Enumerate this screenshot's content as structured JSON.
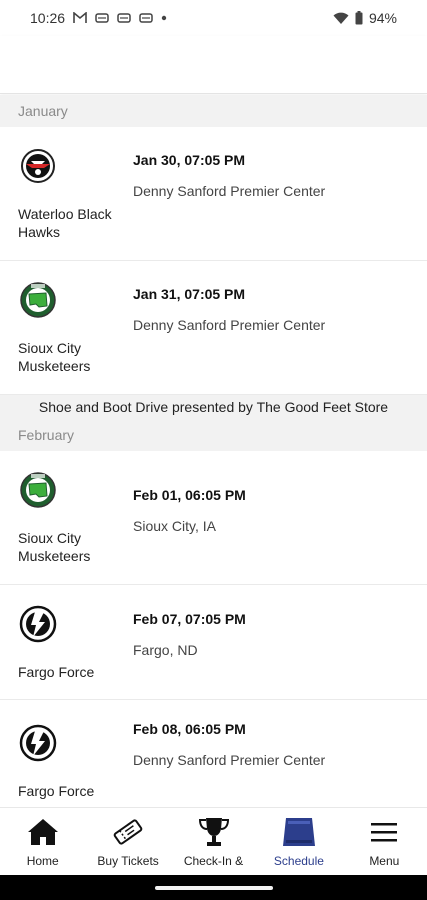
{
  "status_bar": {
    "time": "10:26",
    "battery": "94%",
    "notification_icons": [
      "gmail-icon",
      "notification-icon",
      "notification-icon",
      "notification-icon"
    ]
  },
  "schedule": {
    "sections": [
      {
        "month": "January",
        "games": [
          {
            "opponent": "Waterloo Black Hawks",
            "date_time": "Jan 30, 07:05 PM",
            "venue": "Denny Sanford Premier Center",
            "logo": "waterloo-logo"
          },
          {
            "opponent": "Sioux City Musketeers",
            "date_time": "Jan 31, 07:05 PM",
            "venue": "Denny Sanford Premier Center",
            "logo": "musketeers-logo"
          }
        ],
        "promo": "Shoe and Boot Drive presented by The Good Feet Store"
      },
      {
        "month": "February",
        "games": [
          {
            "opponent": "Sioux City Musketeers",
            "date_time": "Feb 01, 06:05 PM",
            "venue": "Sioux City, IA",
            "logo": "musketeers-logo"
          },
          {
            "opponent": "Fargo Force",
            "date_time": "Feb 07, 07:05 PM",
            "venue": "Fargo, ND",
            "logo": "force-logo"
          },
          {
            "opponent": "Fargo Force",
            "date_time": "Feb 08, 06:05 PM",
            "venue": "Denny Sanford Premier Center",
            "logo": "force-logo"
          }
        ]
      }
    ]
  },
  "bottom_nav": {
    "items": [
      {
        "label": "Home",
        "icon": "home-icon"
      },
      {
        "label": "Buy Tickets",
        "icon": "ticket-icon"
      },
      {
        "label": "Check-In &",
        "icon": "trophy-icon"
      },
      {
        "label": "Schedule",
        "icon": "schedule-icon",
        "active": true
      },
      {
        "label": "Menu",
        "icon": "menu-icon"
      }
    ],
    "active_color": "#2c3e8c"
  }
}
